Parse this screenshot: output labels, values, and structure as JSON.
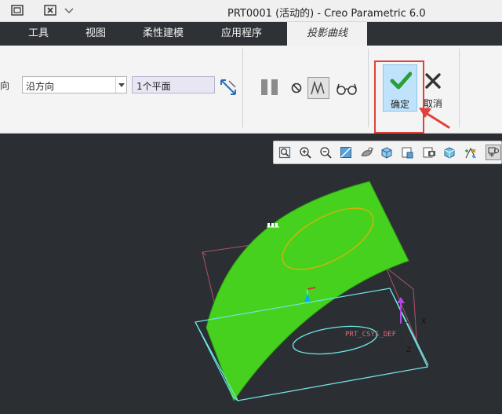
{
  "window": {
    "title": "PRT0001 (活动的) - Creo Parametric 6.0"
  },
  "tabs": [
    {
      "label": "工具"
    },
    {
      "label": "视图"
    },
    {
      "label": "柔性建模"
    },
    {
      "label": "应用程序"
    },
    {
      "label": "投影曲线",
      "active": true
    }
  ],
  "ribbon": {
    "direction_label_partial": "向",
    "direction_select": {
      "value": "沿方向"
    },
    "plane_collector": {
      "value": "1个平面"
    },
    "ok_label": "确定",
    "cancel_label": "取消"
  },
  "model": {
    "csys_label": "PRT_CSYS_DEF",
    "axis_x": "X",
    "axis_z": "Z"
  },
  "colors": {
    "surface_green": "#46d11f",
    "projected_curve": "#e0b200",
    "sketch_curve": "#6ee7e7",
    "highlight_red": "#e0413a",
    "ok_bg": "#bfe3fb"
  }
}
